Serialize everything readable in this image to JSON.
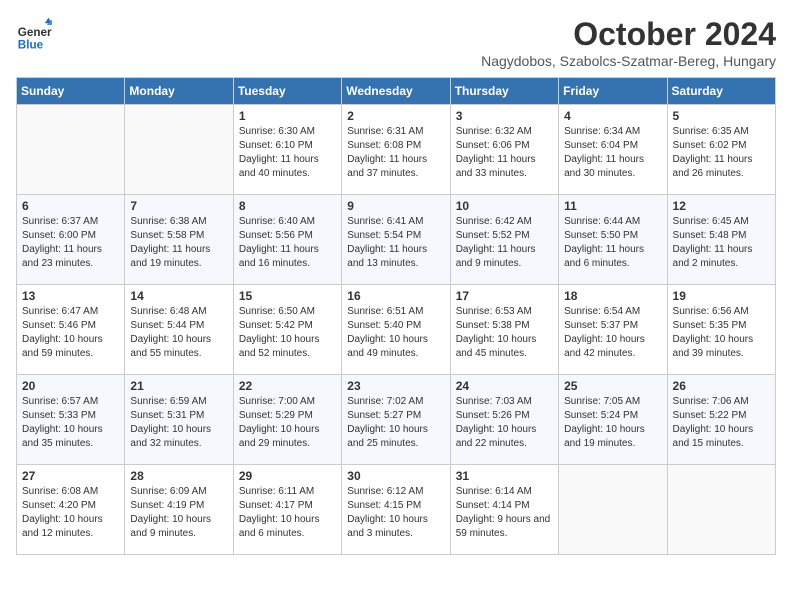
{
  "header": {
    "logo_general": "General",
    "logo_blue": "Blue",
    "title": "October 2024",
    "subtitle": "Nagydobos, Szabolcs-Szatmar-Bereg, Hungary"
  },
  "days_of_week": [
    "Sunday",
    "Monday",
    "Tuesday",
    "Wednesday",
    "Thursday",
    "Friday",
    "Saturday"
  ],
  "weeks": [
    [
      {
        "day": "",
        "content": ""
      },
      {
        "day": "",
        "content": ""
      },
      {
        "day": "1",
        "content": "Sunrise: 6:30 AM\nSunset: 6:10 PM\nDaylight: 11 hours and 40 minutes."
      },
      {
        "day": "2",
        "content": "Sunrise: 6:31 AM\nSunset: 6:08 PM\nDaylight: 11 hours and 37 minutes."
      },
      {
        "day": "3",
        "content": "Sunrise: 6:32 AM\nSunset: 6:06 PM\nDaylight: 11 hours and 33 minutes."
      },
      {
        "day": "4",
        "content": "Sunrise: 6:34 AM\nSunset: 6:04 PM\nDaylight: 11 hours and 30 minutes."
      },
      {
        "day": "5",
        "content": "Sunrise: 6:35 AM\nSunset: 6:02 PM\nDaylight: 11 hours and 26 minutes."
      }
    ],
    [
      {
        "day": "6",
        "content": "Sunrise: 6:37 AM\nSunset: 6:00 PM\nDaylight: 11 hours and 23 minutes."
      },
      {
        "day": "7",
        "content": "Sunrise: 6:38 AM\nSunset: 5:58 PM\nDaylight: 11 hours and 19 minutes."
      },
      {
        "day": "8",
        "content": "Sunrise: 6:40 AM\nSunset: 5:56 PM\nDaylight: 11 hours and 16 minutes."
      },
      {
        "day": "9",
        "content": "Sunrise: 6:41 AM\nSunset: 5:54 PM\nDaylight: 11 hours and 13 minutes."
      },
      {
        "day": "10",
        "content": "Sunrise: 6:42 AM\nSunset: 5:52 PM\nDaylight: 11 hours and 9 minutes."
      },
      {
        "day": "11",
        "content": "Sunrise: 6:44 AM\nSunset: 5:50 PM\nDaylight: 11 hours and 6 minutes."
      },
      {
        "day": "12",
        "content": "Sunrise: 6:45 AM\nSunset: 5:48 PM\nDaylight: 11 hours and 2 minutes."
      }
    ],
    [
      {
        "day": "13",
        "content": "Sunrise: 6:47 AM\nSunset: 5:46 PM\nDaylight: 10 hours and 59 minutes."
      },
      {
        "day": "14",
        "content": "Sunrise: 6:48 AM\nSunset: 5:44 PM\nDaylight: 10 hours and 55 minutes."
      },
      {
        "day": "15",
        "content": "Sunrise: 6:50 AM\nSunset: 5:42 PM\nDaylight: 10 hours and 52 minutes."
      },
      {
        "day": "16",
        "content": "Sunrise: 6:51 AM\nSunset: 5:40 PM\nDaylight: 10 hours and 49 minutes."
      },
      {
        "day": "17",
        "content": "Sunrise: 6:53 AM\nSunset: 5:38 PM\nDaylight: 10 hours and 45 minutes."
      },
      {
        "day": "18",
        "content": "Sunrise: 6:54 AM\nSunset: 5:37 PM\nDaylight: 10 hours and 42 minutes."
      },
      {
        "day": "19",
        "content": "Sunrise: 6:56 AM\nSunset: 5:35 PM\nDaylight: 10 hours and 39 minutes."
      }
    ],
    [
      {
        "day": "20",
        "content": "Sunrise: 6:57 AM\nSunset: 5:33 PM\nDaylight: 10 hours and 35 minutes."
      },
      {
        "day": "21",
        "content": "Sunrise: 6:59 AM\nSunset: 5:31 PM\nDaylight: 10 hours and 32 minutes."
      },
      {
        "day": "22",
        "content": "Sunrise: 7:00 AM\nSunset: 5:29 PM\nDaylight: 10 hours and 29 minutes."
      },
      {
        "day": "23",
        "content": "Sunrise: 7:02 AM\nSunset: 5:27 PM\nDaylight: 10 hours and 25 minutes."
      },
      {
        "day": "24",
        "content": "Sunrise: 7:03 AM\nSunset: 5:26 PM\nDaylight: 10 hours and 22 minutes."
      },
      {
        "day": "25",
        "content": "Sunrise: 7:05 AM\nSunset: 5:24 PM\nDaylight: 10 hours and 19 minutes."
      },
      {
        "day": "26",
        "content": "Sunrise: 7:06 AM\nSunset: 5:22 PM\nDaylight: 10 hours and 15 minutes."
      }
    ],
    [
      {
        "day": "27",
        "content": "Sunrise: 6:08 AM\nSunset: 4:20 PM\nDaylight: 10 hours and 12 minutes."
      },
      {
        "day": "28",
        "content": "Sunrise: 6:09 AM\nSunset: 4:19 PM\nDaylight: 10 hours and 9 minutes."
      },
      {
        "day": "29",
        "content": "Sunrise: 6:11 AM\nSunset: 4:17 PM\nDaylight: 10 hours and 6 minutes."
      },
      {
        "day": "30",
        "content": "Sunrise: 6:12 AM\nSunset: 4:15 PM\nDaylight: 10 hours and 3 minutes."
      },
      {
        "day": "31",
        "content": "Sunrise: 6:14 AM\nSunset: 4:14 PM\nDaylight: 9 hours and 59 minutes."
      },
      {
        "day": "",
        "content": ""
      },
      {
        "day": "",
        "content": ""
      }
    ]
  ]
}
